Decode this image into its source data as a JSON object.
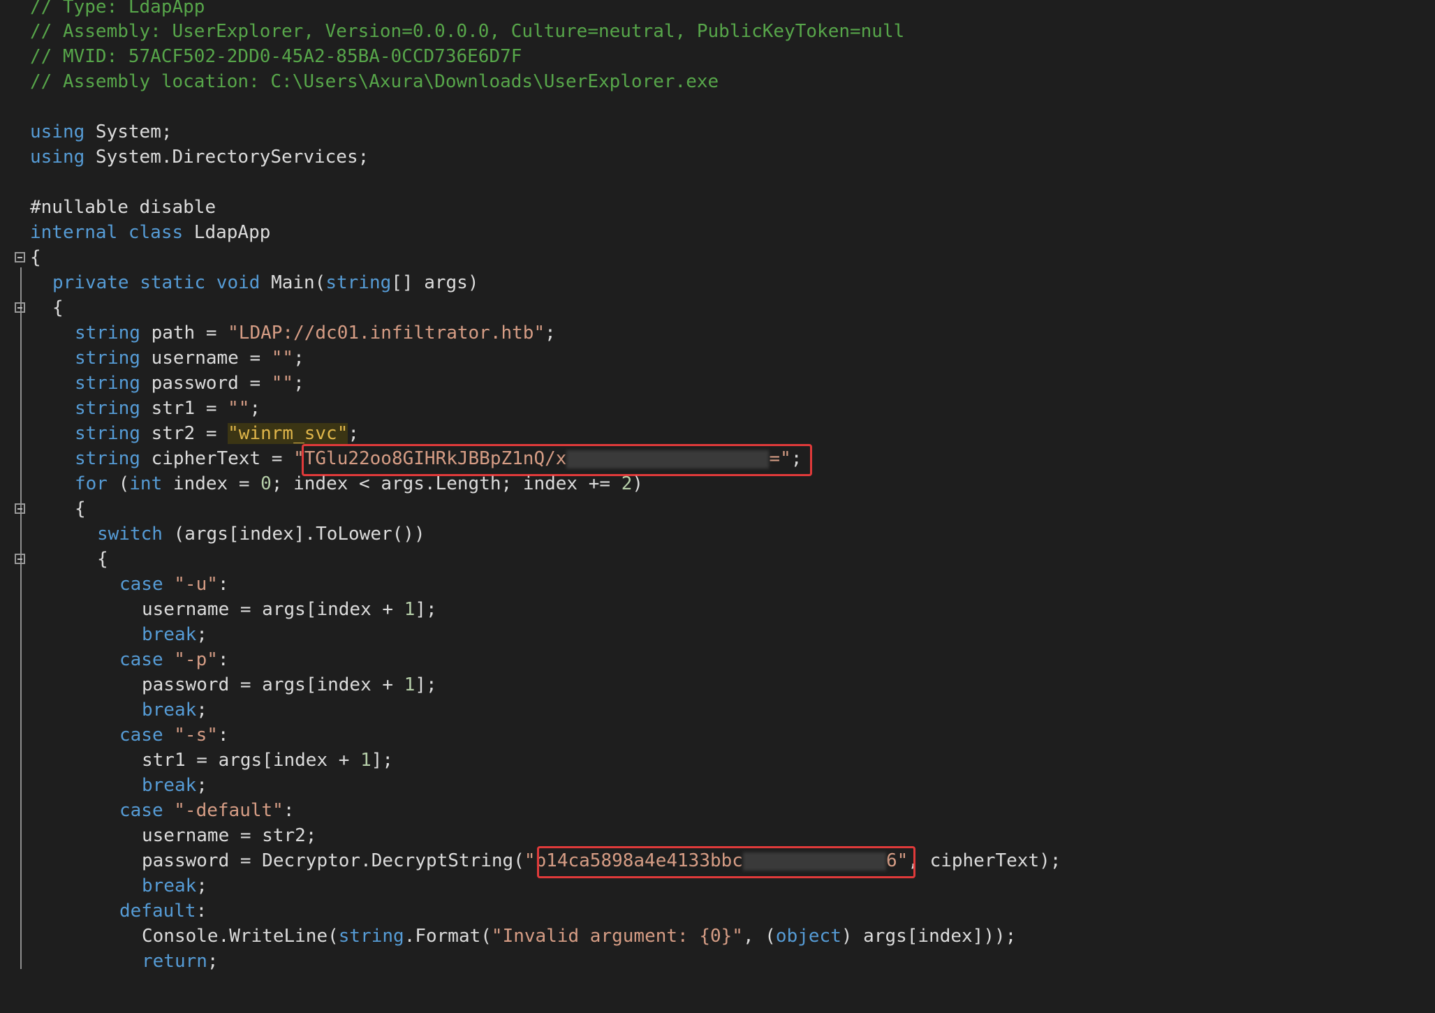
{
  "code": {
    "comment_type": "// Type: LdapApp",
    "comment_assembly": "// Assembly: UserExplorer, Version=0.0.0.0, Culture=neutral, PublicKeyToken=null",
    "comment_mvid": "// MVID: 57ACF502-2DD0-45A2-85BA-0CCD736E6D7F",
    "comment_location": "// Assembly location: C:\\Users\\Axura\\Downloads\\UserExplorer.exe",
    "using_kw": "using",
    "using1_ns": " System;",
    "using2_ns": " System.DirectoryServices;",
    "nullable": "#nullable disable",
    "class_kw": "internal class",
    "class_name": " LdapApp",
    "brace_open": "{",
    "brace_close": "}",
    "main_kw": "private static void",
    "main_name": " Main(",
    "main_type": "string",
    "main_args": "[] args)",
    "string_kw": "string",
    "path_var": " path = ",
    "path_val": "\"LDAP://dc01.infiltrator.htb\"",
    "username_var": " username = ",
    "password_var": " password = ",
    "str1_var": " str1 = ",
    "empty_str": "\"\"",
    "semicolon": ";",
    "str2_var": " str2 = ",
    "str2_val": "\"winrm_svc\"",
    "cipher_var": " cipherText = ",
    "cipher_visible": "\"TGlu22oo8GIHRkJBBpZ1nQ/x",
    "cipher_tail": "=\"",
    "for_kw": "for",
    "for_open": " (",
    "int_kw": "int",
    "for_index": " index = ",
    "zero": "0",
    "for_cond": "; index < args.Length; index += ",
    "two": "2",
    "for_close": ")",
    "switch_kw": "switch",
    "switch_expr": " (args[index].ToLower())",
    "case_kw": "case",
    "case_u": "\"-u\"",
    "case_p": "\"-p\"",
    "case_s": "\"-s\"",
    "case_default": "\"-default\"",
    "colon": ":",
    "assign_username": "username = args[index + ",
    "assign_password": "password = args[index + ",
    "assign_str1": "str1 = args[index + ",
    "one": "1",
    "idx_close": "];",
    "break_kw": "break",
    "username_str2": "username = str2;",
    "decrypt_call": "password = Decryptor.DecryptString(",
    "key_visible": "\"b14ca5898a4e4133bbc",
    "key_tail": "6\"",
    "decrypt_rest": ", cipherText);",
    "default_kw": "default",
    "console_call": "Console.WriteLine(",
    "format_call": ".Format(",
    "format_str": "\"Invalid argument: {0}\"",
    "object_open": ", (",
    "object_kw": "object",
    "object_rest": ") args[index]));",
    "return_kw": "return"
  },
  "colors": {
    "background": "#1e1e1e",
    "keyword": "#569cd6",
    "string": "#d69d85",
    "comment": "#57a64a",
    "highlight": "#e03a3a"
  }
}
